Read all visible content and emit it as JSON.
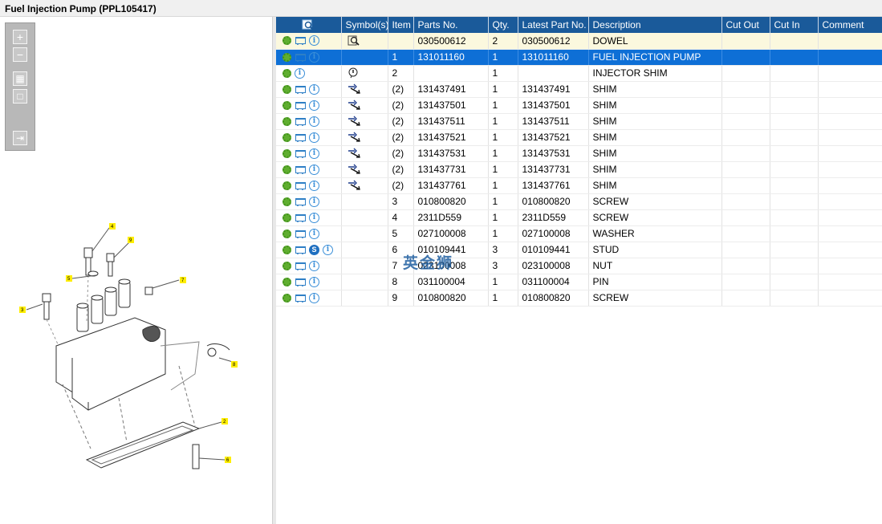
{
  "window": {
    "title": "Fuel Injection Pump (PPL105417)"
  },
  "toolbar": {
    "buttons": [
      {
        "name": "zoom-in-button",
        "glyph": "+"
      },
      {
        "name": "zoom-out-button",
        "glyph": "−"
      },
      {
        "name": "fit-all-button",
        "glyph": "▦"
      },
      {
        "name": "fit-page-button",
        "glyph": "□"
      },
      {
        "name": "export-button",
        "glyph": "⇥"
      }
    ]
  },
  "drawing": {
    "callouts": [
      "4",
      "9",
      "5",
      "7",
      "3",
      "8",
      "2",
      "6"
    ]
  },
  "table": {
    "columns": [
      "",
      "Symbol(s)",
      "Item",
      "Parts No.",
      "Qty.",
      "Latest Part No.",
      "Description",
      "Cut Out",
      "Cut In",
      "Comment"
    ],
    "rows": [
      {
        "icons": [
          "gear",
          "cart",
          "info"
        ],
        "symbol": "magnifier",
        "item": "",
        "parts_no": "030500612",
        "qty": "2",
        "latest": "030500612",
        "description": "DOWEL",
        "cut_out": "",
        "cut_in": "",
        "comment": "",
        "state": "first"
      },
      {
        "icons": [
          "gear",
          "cart",
          "info"
        ],
        "symbol": "",
        "item": "1",
        "parts_no": "131011160",
        "qty": "1",
        "latest": "131011160",
        "description": "FUEL INJECTION PUMP",
        "cut_out": "",
        "cut_in": "",
        "comment": "",
        "state": "selected"
      },
      {
        "icons": [
          "gear",
          "info"
        ],
        "symbol": "note",
        "item": "2",
        "parts_no": "",
        "qty": "1",
        "latest": "",
        "description": "INJECTOR SHIM",
        "cut_out": "",
        "cut_in": "",
        "comment": "",
        "state": ""
      },
      {
        "icons": [
          "gear",
          "cart",
          "info"
        ],
        "symbol": "alternate",
        "item": "(2)",
        "parts_no": "131437491",
        "qty": "1",
        "latest": "131437491",
        "description": "SHIM",
        "cut_out": "",
        "cut_in": "",
        "comment": "",
        "state": ""
      },
      {
        "icons": [
          "gear",
          "cart",
          "info"
        ],
        "symbol": "alternate",
        "item": "(2)",
        "parts_no": "131437501",
        "qty": "1",
        "latest": "131437501",
        "description": "SHIM",
        "cut_out": "",
        "cut_in": "",
        "comment": "",
        "state": ""
      },
      {
        "icons": [
          "gear",
          "cart",
          "info"
        ],
        "symbol": "alternate",
        "item": "(2)",
        "parts_no": "131437511",
        "qty": "1",
        "latest": "131437511",
        "description": "SHIM",
        "cut_out": "",
        "cut_in": "",
        "comment": "",
        "state": ""
      },
      {
        "icons": [
          "gear",
          "cart",
          "info"
        ],
        "symbol": "alternate",
        "item": "(2)",
        "parts_no": "131437521",
        "qty": "1",
        "latest": "131437521",
        "description": "SHIM",
        "cut_out": "",
        "cut_in": "",
        "comment": "",
        "state": ""
      },
      {
        "icons": [
          "gear",
          "cart",
          "info"
        ],
        "symbol": "alternate",
        "item": "(2)",
        "parts_no": "131437531",
        "qty": "1",
        "latest": "131437531",
        "description": "SHIM",
        "cut_out": "",
        "cut_in": "",
        "comment": "",
        "state": ""
      },
      {
        "icons": [
          "gear",
          "cart",
          "info"
        ],
        "symbol": "alternate",
        "item": "(2)",
        "parts_no": "131437731",
        "qty": "1",
        "latest": "131437731",
        "description": "SHIM",
        "cut_out": "",
        "cut_in": "",
        "comment": "",
        "state": ""
      },
      {
        "icons": [
          "gear",
          "cart",
          "info"
        ],
        "symbol": "alternate",
        "item": "(2)",
        "parts_no": "131437761",
        "qty": "1",
        "latest": "131437761",
        "description": "SHIM",
        "cut_out": "",
        "cut_in": "",
        "comment": "",
        "state": ""
      },
      {
        "icons": [
          "gear",
          "cart",
          "info"
        ],
        "symbol": "",
        "item": "3",
        "parts_no": "010800820",
        "qty": "1",
        "latest": "010800820",
        "description": "SCREW",
        "cut_out": "",
        "cut_in": "",
        "comment": "",
        "state": ""
      },
      {
        "icons": [
          "gear",
          "cart",
          "info"
        ],
        "symbol": "",
        "item": "4",
        "parts_no": "2311D559",
        "qty": "1",
        "latest": "2311D559",
        "description": "SCREW",
        "cut_out": "",
        "cut_in": "",
        "comment": "",
        "state": ""
      },
      {
        "icons": [
          "gear",
          "cart",
          "info"
        ],
        "symbol": "",
        "item": "5",
        "parts_no": "027100008",
        "qty": "1",
        "latest": "027100008",
        "description": "WASHER",
        "cut_out": "",
        "cut_in": "",
        "comment": "",
        "state": ""
      },
      {
        "icons": [
          "gear",
          "cart",
          "s",
          "info"
        ],
        "symbol": "",
        "item": "6",
        "parts_no": "010109441",
        "qty": "3",
        "latest": "010109441",
        "description": "STUD",
        "cut_out": "",
        "cut_in": "",
        "comment": "",
        "state": ""
      },
      {
        "icons": [
          "gear",
          "cart",
          "info"
        ],
        "symbol": "",
        "item": "7",
        "parts_no": "023100008",
        "qty": "3",
        "latest": "023100008",
        "description": "NUT",
        "cut_out": "",
        "cut_in": "",
        "comment": "",
        "state": ""
      },
      {
        "icons": [
          "gear",
          "cart",
          "info"
        ],
        "symbol": "",
        "item": "8",
        "parts_no": "031100004",
        "qty": "1",
        "latest": "031100004",
        "description": "PIN",
        "cut_out": "",
        "cut_in": "",
        "comment": "",
        "state": ""
      },
      {
        "icons": [
          "gear",
          "cart",
          "info"
        ],
        "symbol": "",
        "item": "9",
        "parts_no": "010800820",
        "qty": "1",
        "latest": "010800820",
        "description": "SCREW",
        "cut_out": "",
        "cut_in": "",
        "comment": "",
        "state": ""
      }
    ]
  },
  "watermark": {
    "text": "英金狮"
  },
  "colors": {
    "header": "#1a5a9a",
    "selected": "#0e6fd6",
    "first_row": "#fbf8de",
    "gear": "#5fae2f",
    "icon_blue": "#2e7fc6"
  }
}
